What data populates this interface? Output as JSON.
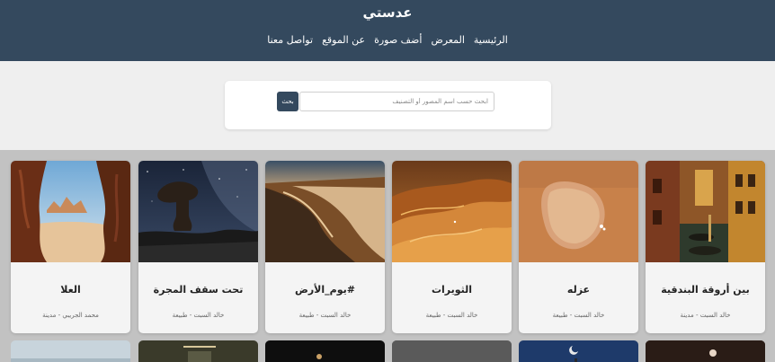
{
  "header": {
    "title": "عدستي",
    "nav": [
      "الرئيسية",
      "المعرض",
      "أضف صورة",
      "عن الموقع",
      "تواصل معنا"
    ]
  },
  "search": {
    "placeholder": "ابحث حسب اسم المصور أو التصنيف",
    "button_label": "بحث"
  },
  "gallery": {
    "cards": [
      {
        "title": "بين أروقة البندقية",
        "meta": "خالد السبت - مدينة"
      },
      {
        "title": "عزله",
        "meta": "خالد السبت - طبيعة"
      },
      {
        "title": "الثويرات",
        "meta": "خالد السبت - طبيعة"
      },
      {
        "title": "#يوم_الأرض",
        "meta": "خالد السبت - طبيعة"
      },
      {
        "title": "تحت سقف المجرة",
        "meta": "خالد السبت - طبيعة"
      },
      {
        "title": "العلا",
        "meta": "محمد الجريبي - مدينة"
      }
    ]
  }
}
